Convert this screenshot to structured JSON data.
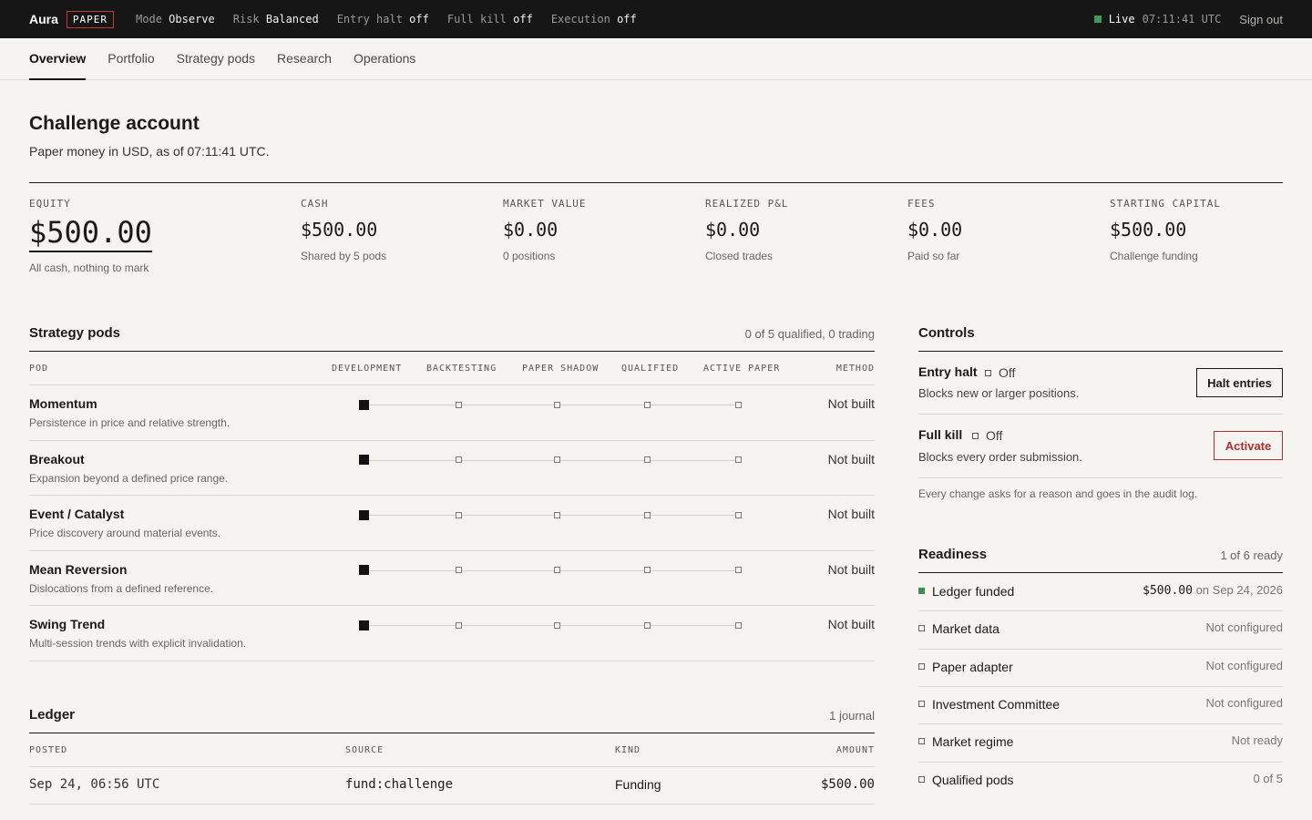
{
  "topbar": {
    "brand": "Aura",
    "mode_badge": "PAPER",
    "stats": [
      {
        "label": "Mode",
        "value": "Observe"
      },
      {
        "label": "Risk",
        "value": "Balanced"
      },
      {
        "label": "Entry halt",
        "value": "off"
      },
      {
        "label": "Full kill",
        "value": "off"
      },
      {
        "label": "Execution",
        "value": "off"
      }
    ],
    "live_label": "Live",
    "live_time": "07:11:41 UTC",
    "live_color": "#3f9a5b",
    "sign_out": "Sign out"
  },
  "nav": {
    "tabs": [
      "Overview",
      "Portfolio",
      "Strategy pods",
      "Research",
      "Operations"
    ],
    "active": "Overview"
  },
  "page": {
    "title": "Challenge account",
    "subtitle": "Paper money in USD, as of 07:11:41 UTC."
  },
  "metrics": [
    {
      "label": "EQUITY",
      "value": "$500.00",
      "note": "All cash, nothing to mark"
    },
    {
      "label": "CASH",
      "value": "$500.00",
      "note": "Shared by 5 pods"
    },
    {
      "label": "MARKET VALUE",
      "value": "$0.00",
      "note": "0 positions"
    },
    {
      "label": "REALIZED P&L",
      "value": "$0.00",
      "note": "Closed trades"
    },
    {
      "label": "FEES",
      "value": "$0.00",
      "note": "Paid so far"
    },
    {
      "label": "STARTING CAPITAL",
      "value": "$500.00",
      "note": "Challenge funding"
    }
  ],
  "pods": {
    "title": "Strategy pods",
    "meta": "0 of 5 qualified, 0 trading",
    "columns": {
      "pod": "POD",
      "stages": [
        "DEVELOPMENT",
        "BACKTESTING",
        "PAPER SHADOW",
        "QUALIFIED",
        "ACTIVE PAPER"
      ],
      "method": "METHOD"
    },
    "rows": [
      {
        "name": "Momentum",
        "desc": "Persistence in price and relative strength.",
        "stage": 0,
        "method": "Not built"
      },
      {
        "name": "Breakout",
        "desc": "Expansion beyond a defined price range.",
        "stage": 0,
        "method": "Not built"
      },
      {
        "name": "Event / Catalyst",
        "desc": "Price discovery around material events.",
        "stage": 0,
        "method": "Not built"
      },
      {
        "name": "Mean Reversion",
        "desc": "Dislocations from a defined reference.",
        "stage": 0,
        "method": "Not built"
      },
      {
        "name": "Swing Trend",
        "desc": "Multi-session trends with explicit invalidation.",
        "stage": 0,
        "method": "Not built"
      }
    ]
  },
  "ledger": {
    "title": "Ledger",
    "meta": "1 journal",
    "columns": [
      "POSTED",
      "SOURCE",
      "KIND",
      "AMOUNT"
    ],
    "rows": [
      {
        "posted": "Sep 24, 06:56 UTC",
        "source": "fund:challenge",
        "kind": "Funding",
        "amount": "$500.00"
      }
    ]
  },
  "controls": {
    "title": "Controls",
    "entry_halt": {
      "name": "Entry halt",
      "state": "Off",
      "desc": "Blocks new or larger positions.",
      "button": "Halt entries"
    },
    "full_kill": {
      "name": "Full kill",
      "state": "Off",
      "desc": "Blocks every order submission.",
      "button": "Activate"
    },
    "note": "Every change asks for a reason and goes in the audit log.",
    "danger_color": "#a8322d"
  },
  "readiness": {
    "title": "Readiness",
    "meta": "1 of 6 ready",
    "items": [
      {
        "label": "Ledger funded",
        "ready": true,
        "amount": "$500.00",
        "value": "on Sep 24, 2026"
      },
      {
        "label": "Market data",
        "ready": false,
        "value": "Not configured"
      },
      {
        "label": "Paper adapter",
        "ready": false,
        "value": "Not configured"
      },
      {
        "label": "Investment Committee",
        "ready": false,
        "value": "Not configured"
      },
      {
        "label": "Market regime",
        "ready": false,
        "value": "Not ready"
      },
      {
        "label": "Qualified pods",
        "ready": false,
        "value": "0 of 5"
      }
    ]
  }
}
